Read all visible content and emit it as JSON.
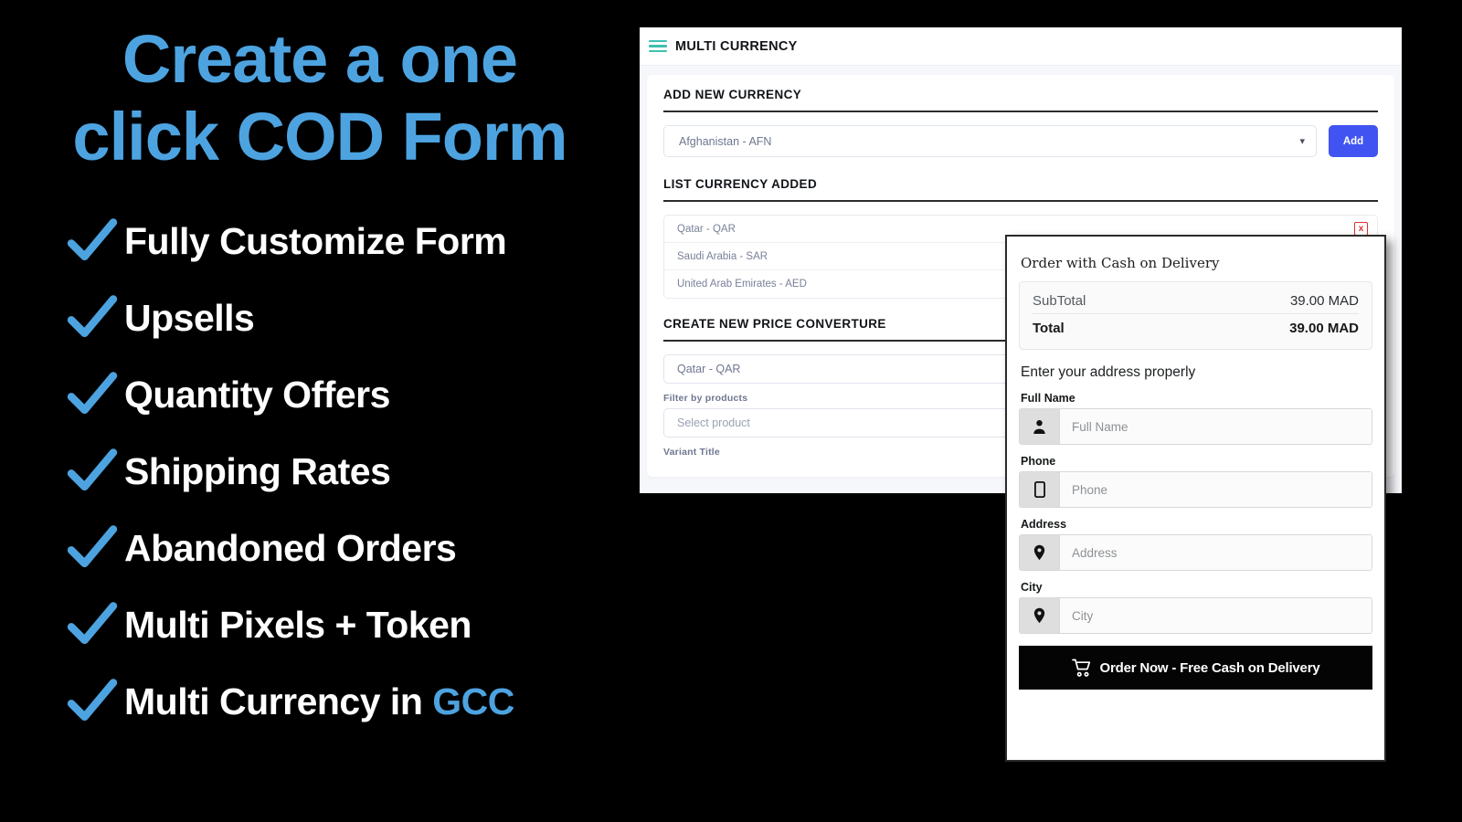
{
  "promo": {
    "title_line1": "Create a one",
    "title_line2": "click COD Form",
    "accent_color": "#4da3e0",
    "check_icon": "check-icon",
    "features": [
      {
        "text": "Fully Customize Form"
      },
      {
        "text": "Upsells"
      },
      {
        "text": "Quantity Offers"
      },
      {
        "text": "Shipping Rates"
      },
      {
        "text": "Abandoned Orders"
      },
      {
        "text": "Multi Pixels + Token"
      },
      {
        "text": "Multi Currency in ",
        "highlight": "GCC"
      }
    ]
  },
  "admin": {
    "menu_icon": "hamburger-menu-icon",
    "title": "MULTI CURRENCY",
    "accent_color": "#3fc0b0",
    "add_currency": {
      "heading": "ADD NEW CURRENCY",
      "select_value": "Afghanistan - AFN",
      "chevron": "⌄",
      "add_button": "Add",
      "add_button_color": "#4154f1"
    },
    "list_currency": {
      "heading": "LIST CURRENCY ADDED",
      "delete_label": "x",
      "delete_color": "#e03131",
      "items": [
        {
          "label": "Qatar - QAR"
        },
        {
          "label": "Saudi Arabia - SAR"
        },
        {
          "label": "United Arab Emirates - AED"
        }
      ]
    },
    "price_converture": {
      "heading": "CREATE NEW PRICE CONVERTURE",
      "currency_value": "Qatar - QAR",
      "filter_label": "Filter by products",
      "product_placeholder": "Select product",
      "variant_label": "Variant Title"
    }
  },
  "cod_form": {
    "heading": "Order with Cash on Delivery",
    "totals": {
      "subtotal_label": "SubTotal",
      "subtotal_value": "39.00 MAD",
      "total_label": "Total",
      "total_value": "39.00 MAD"
    },
    "address_note": "Enter your address properly",
    "fields": [
      {
        "label": "Full Name",
        "placeholder": "Full Name",
        "icon": "person-icon"
      },
      {
        "label": "Phone",
        "placeholder": "Phone",
        "icon": "mobile-phone-icon"
      },
      {
        "label": "Address",
        "placeholder": "Address",
        "icon": "map-pin-icon"
      },
      {
        "label": "City",
        "placeholder": "City",
        "icon": "map-pin-icon"
      }
    ],
    "submit_label": "Order Now - Free Cash on Delivery",
    "submit_icon": "shopping-cart-icon",
    "submit_color": "#040404"
  }
}
